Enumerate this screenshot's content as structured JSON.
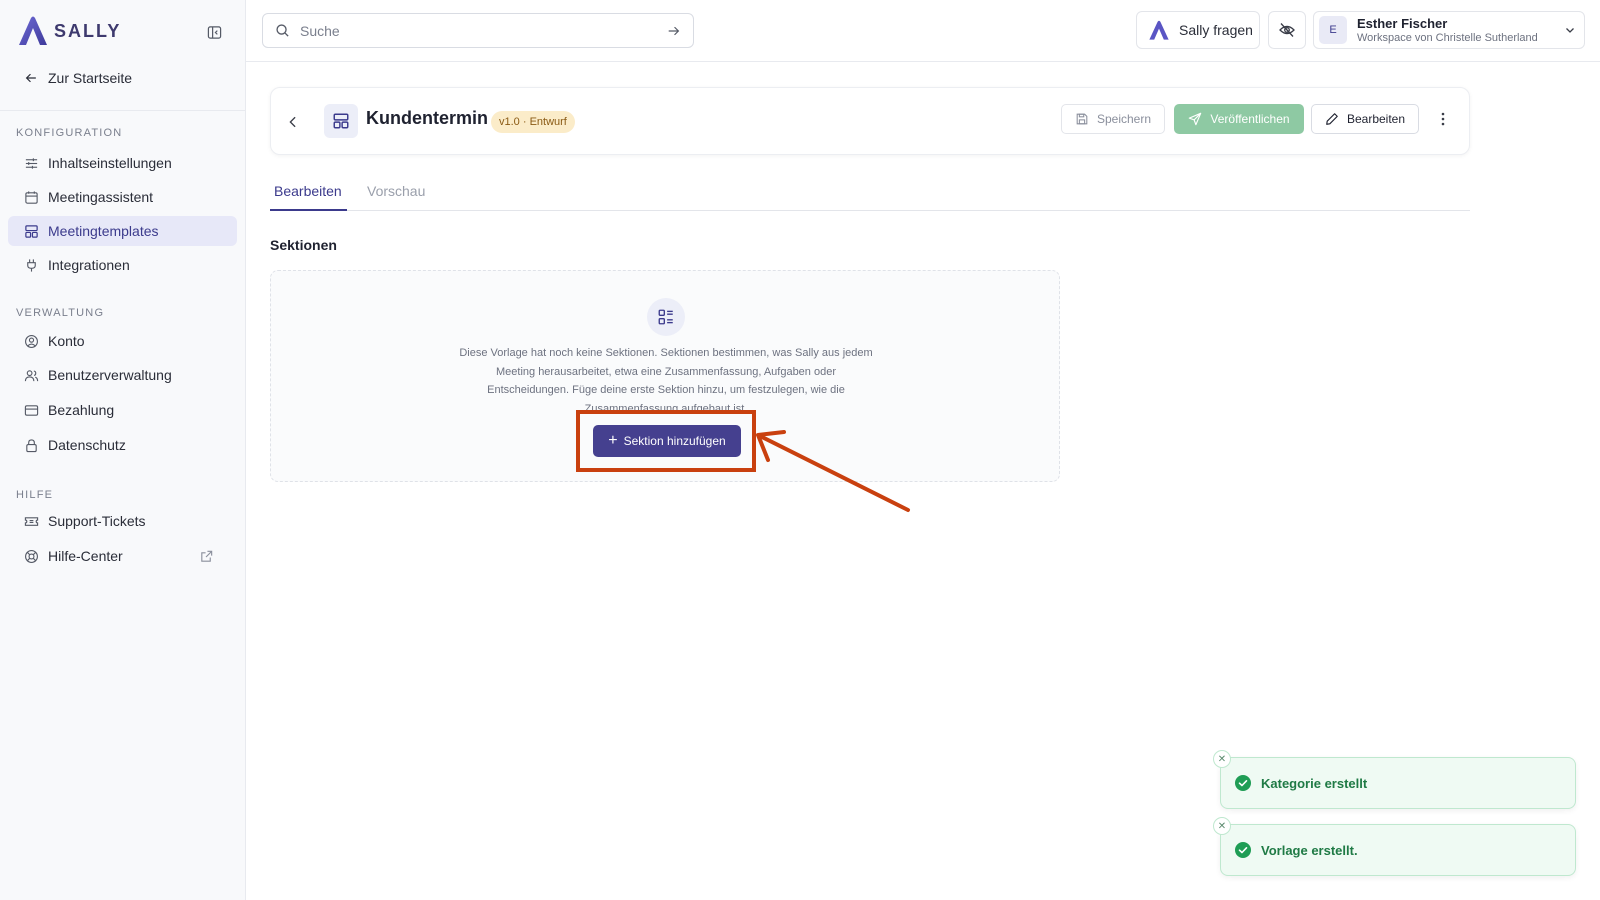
{
  "brand": {
    "name": "SALLY"
  },
  "sidebar": {
    "home_link": "Zur Startseite",
    "sections": [
      {
        "label": "KONFIGURATION",
        "items": [
          {
            "label": "Inhaltseinstellungen",
            "icon": "sliders-icon"
          },
          {
            "label": "Meetingassistent",
            "icon": "calendar-icon"
          },
          {
            "label": "Meetingtemplates",
            "icon": "layout-template-icon",
            "active": true
          },
          {
            "label": "Integrationen",
            "icon": "plug-icon"
          }
        ]
      },
      {
        "label": "VERWALTUNG",
        "items": [
          {
            "label": "Konto",
            "icon": "user-circle-icon"
          },
          {
            "label": "Benutzerverwaltung",
            "icon": "users-icon"
          },
          {
            "label": "Bezahlung",
            "icon": "credit-card-icon"
          },
          {
            "label": "Datenschutz",
            "icon": "lock-icon"
          }
        ]
      },
      {
        "label": "HILFE",
        "items": [
          {
            "label": "Support-Tickets",
            "icon": "ticket-icon"
          },
          {
            "label": "Hilfe-Center",
            "icon": "lifebuoy-icon"
          }
        ]
      }
    ]
  },
  "topbar": {
    "search_placeholder": "Suche",
    "ask_label": "Sally fragen",
    "user": {
      "initial": "E",
      "name": "Esther Fischer",
      "workspace": "Workspace von Christelle Sutherland"
    }
  },
  "template": {
    "title": "Kundentermin",
    "version_badge": "v1.0 · Entwurf",
    "save_label": "Speichern",
    "publish_label": "Veröffentlichen",
    "edit_label": "Bearbeiten"
  },
  "tabs": {
    "edit": "Bearbeiten",
    "preview": "Vorschau"
  },
  "sections_panel": {
    "heading": "Sektionen",
    "empty_text": "Diese Vorlage hat noch keine Sektionen. Sektionen bestimmen, was Sally aus jedem Meeting herausarbeitet, etwa eine Zusammenfassung, Aufgaben oder Entscheidungen. Füge deine erste Sektion hinzu, um festzulegen, wie die Zusammenfassung aufgebaut ist.",
    "add_button": "Sektion hinzufügen"
  },
  "toasts": [
    {
      "text": "Kategorie erstellt"
    },
    {
      "text": "Vorlage erstellt."
    }
  ],
  "colors": {
    "accent": "#45408f",
    "annotation": "#c9400f",
    "success": "#1f9d55"
  }
}
